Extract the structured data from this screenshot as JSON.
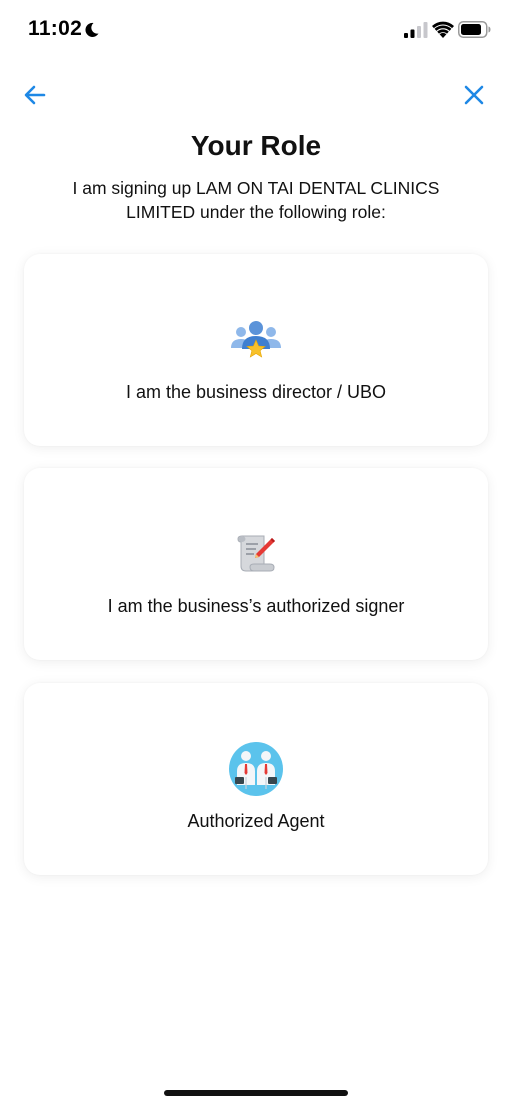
{
  "status_bar": {
    "time": "11:02",
    "icons": [
      "moon-icon",
      "cellular-signal-icon",
      "wifi-icon",
      "battery-icon"
    ]
  },
  "nav": {
    "back_icon": "arrow-left-icon",
    "close_icon": "close-icon",
    "accent_color": "#1e88e5"
  },
  "header": {
    "title": "Your Role",
    "subtitle": "I am signing up LAM ON TAI DENTAL CLINICS LIMITED under the following role:"
  },
  "roles": [
    {
      "icon": "group-star-icon",
      "label": "I am the business director / UBO"
    },
    {
      "icon": "scroll-pen-icon",
      "label": "I am the business’s authorized signer"
    },
    {
      "icon": "agents-icon",
      "label": "Authorized Agent"
    }
  ]
}
